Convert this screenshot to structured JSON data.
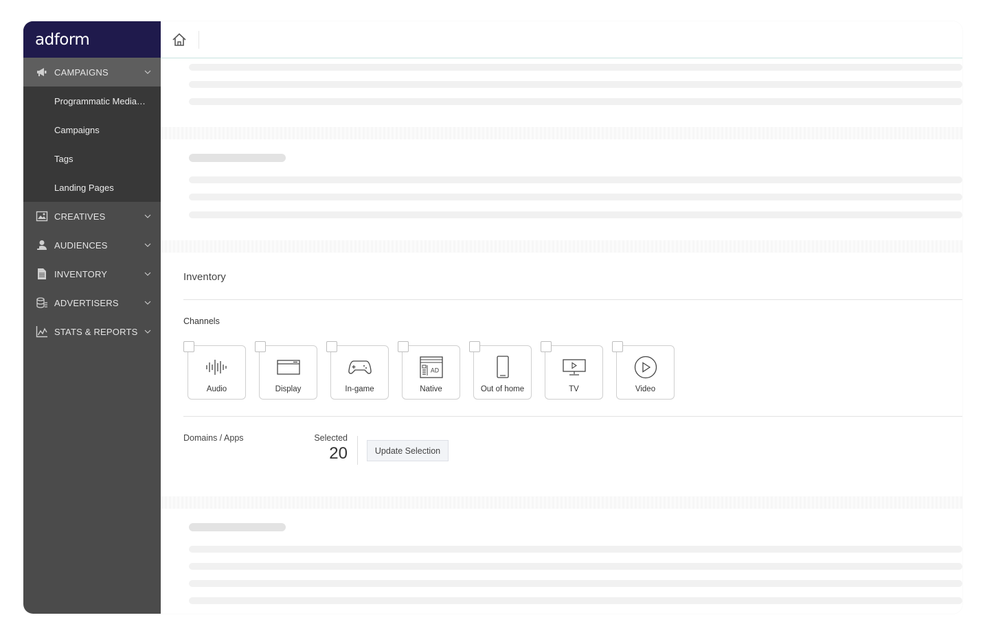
{
  "app": {
    "brand": "adform"
  },
  "sidebar": {
    "items": [
      {
        "label": "CAMPAIGNS",
        "icon": "megaphone-icon",
        "expanded": true,
        "children": [
          "Programmatic Media…",
          "Campaigns",
          "Tags",
          "Landing Pages"
        ]
      },
      {
        "label": "CREATIVES",
        "icon": "image-icon"
      },
      {
        "label": "AUDIENCES",
        "icon": "audience-icon"
      },
      {
        "label": "INVENTORY",
        "icon": "document-icon"
      },
      {
        "label": "ADVERTISERS",
        "icon": "database-icon"
      },
      {
        "label": "STATS & REPORTS",
        "icon": "chart-line-icon"
      }
    ]
  },
  "topbar": {
    "home_icon": "home-icon"
  },
  "inventory": {
    "title": "Inventory",
    "channels_label": "Channels",
    "channels": [
      {
        "label": "Audio",
        "icon": "audio-wave-icon"
      },
      {
        "label": "Display",
        "icon": "display-window-icon"
      },
      {
        "label": "In-game",
        "icon": "gamepad-icon"
      },
      {
        "label": "Native",
        "icon": "native-ad-icon"
      },
      {
        "label": "Out of home",
        "icon": "phone-icon"
      },
      {
        "label": "TV",
        "icon": "tv-icon"
      },
      {
        "label": "Video",
        "icon": "play-circle-icon"
      }
    ],
    "domains_label": "Domains / Apps",
    "selected_label": "Selected",
    "selected_count": "20",
    "update_button": "Update Selection"
  },
  "colors": {
    "sidebar_bg": "#4b4b4b",
    "brand_bar": "#1f1a4c",
    "submenu_bg": "#383838"
  }
}
